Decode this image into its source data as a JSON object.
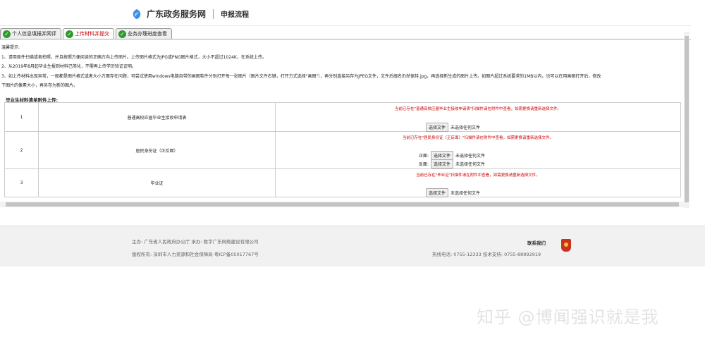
{
  "header": {
    "site_name": "广东政务服务网",
    "page_title": "申报流程"
  },
  "tabs": [
    {
      "label": "个人信息填报并网评",
      "active": false
    },
    {
      "label": "上传材料并提交",
      "active": true
    },
    {
      "label": "业务办理进度查看",
      "active": false
    }
  ],
  "notice": {
    "title": "温馨提示:",
    "line1": "1、请用原件扫描或者拍照，并且按照方便阅读的正确方向上传图片。上传图片格式为JPG或PNG图片格式，大小不超过1024K，在系统上传。",
    "line2": "2、从2019年8月起毕业生报到材料已简化，不需再上传学历验证证明。",
    "line3": "3、如上传材料出现异常，一般都是图片格式或者大小方面存在问题，可尝试使用windows电脑自带的画图软件分别打开每一张图片（图片文件右键，打开方式选择\"画图\"），再分别直接另存为JPEG文件，文件后缀名仍然保持.jpg，再选择新生成的图片上传。如图片超过系统要求的1MB以内，也可以在用画图打开后，修改",
    "line4": "下图片的像素大小，再另存为新的图片。"
  },
  "attachments": {
    "title": "毕业生材料清单附件上传:",
    "rows": [
      {
        "num": "1",
        "name": "普通高校应届毕业生接收申请表",
        "warn": "当前已存在\"普通高校应届毕业生接收申请表\"扫描件请在附件中查看，如需更换请重新选择文件。"
      },
      {
        "num": "2",
        "name": "居民身份证（正反面）",
        "warn": "当前已存在\"居民身份证（正反面）\"扫描件请在附件中查看，如需更换请重新选择文件。",
        "front_label": "正面:",
        "back_label": "反面:"
      },
      {
        "num": "3",
        "name": "毕业证",
        "warn": "当前已存在\"毕业证\"扫描件请在附件中查看，如需更换请重新选择文件。"
      }
    ],
    "choose_btn": "选择文件",
    "no_file": "未选择任何文件"
  },
  "footer": {
    "sponsor": "主办:  广东省人民政府办公厅      承办:  数字广东网络建设有限公司",
    "copyright": "版权所有:  深圳市人力资源和社会保障局    粤ICP备05017767号",
    "contact_title": "联系我们",
    "contact": "热线电话:  0755-12333 技术支持:  0755-88892919"
  },
  "watermark": "知乎 @博闻强识就是我"
}
